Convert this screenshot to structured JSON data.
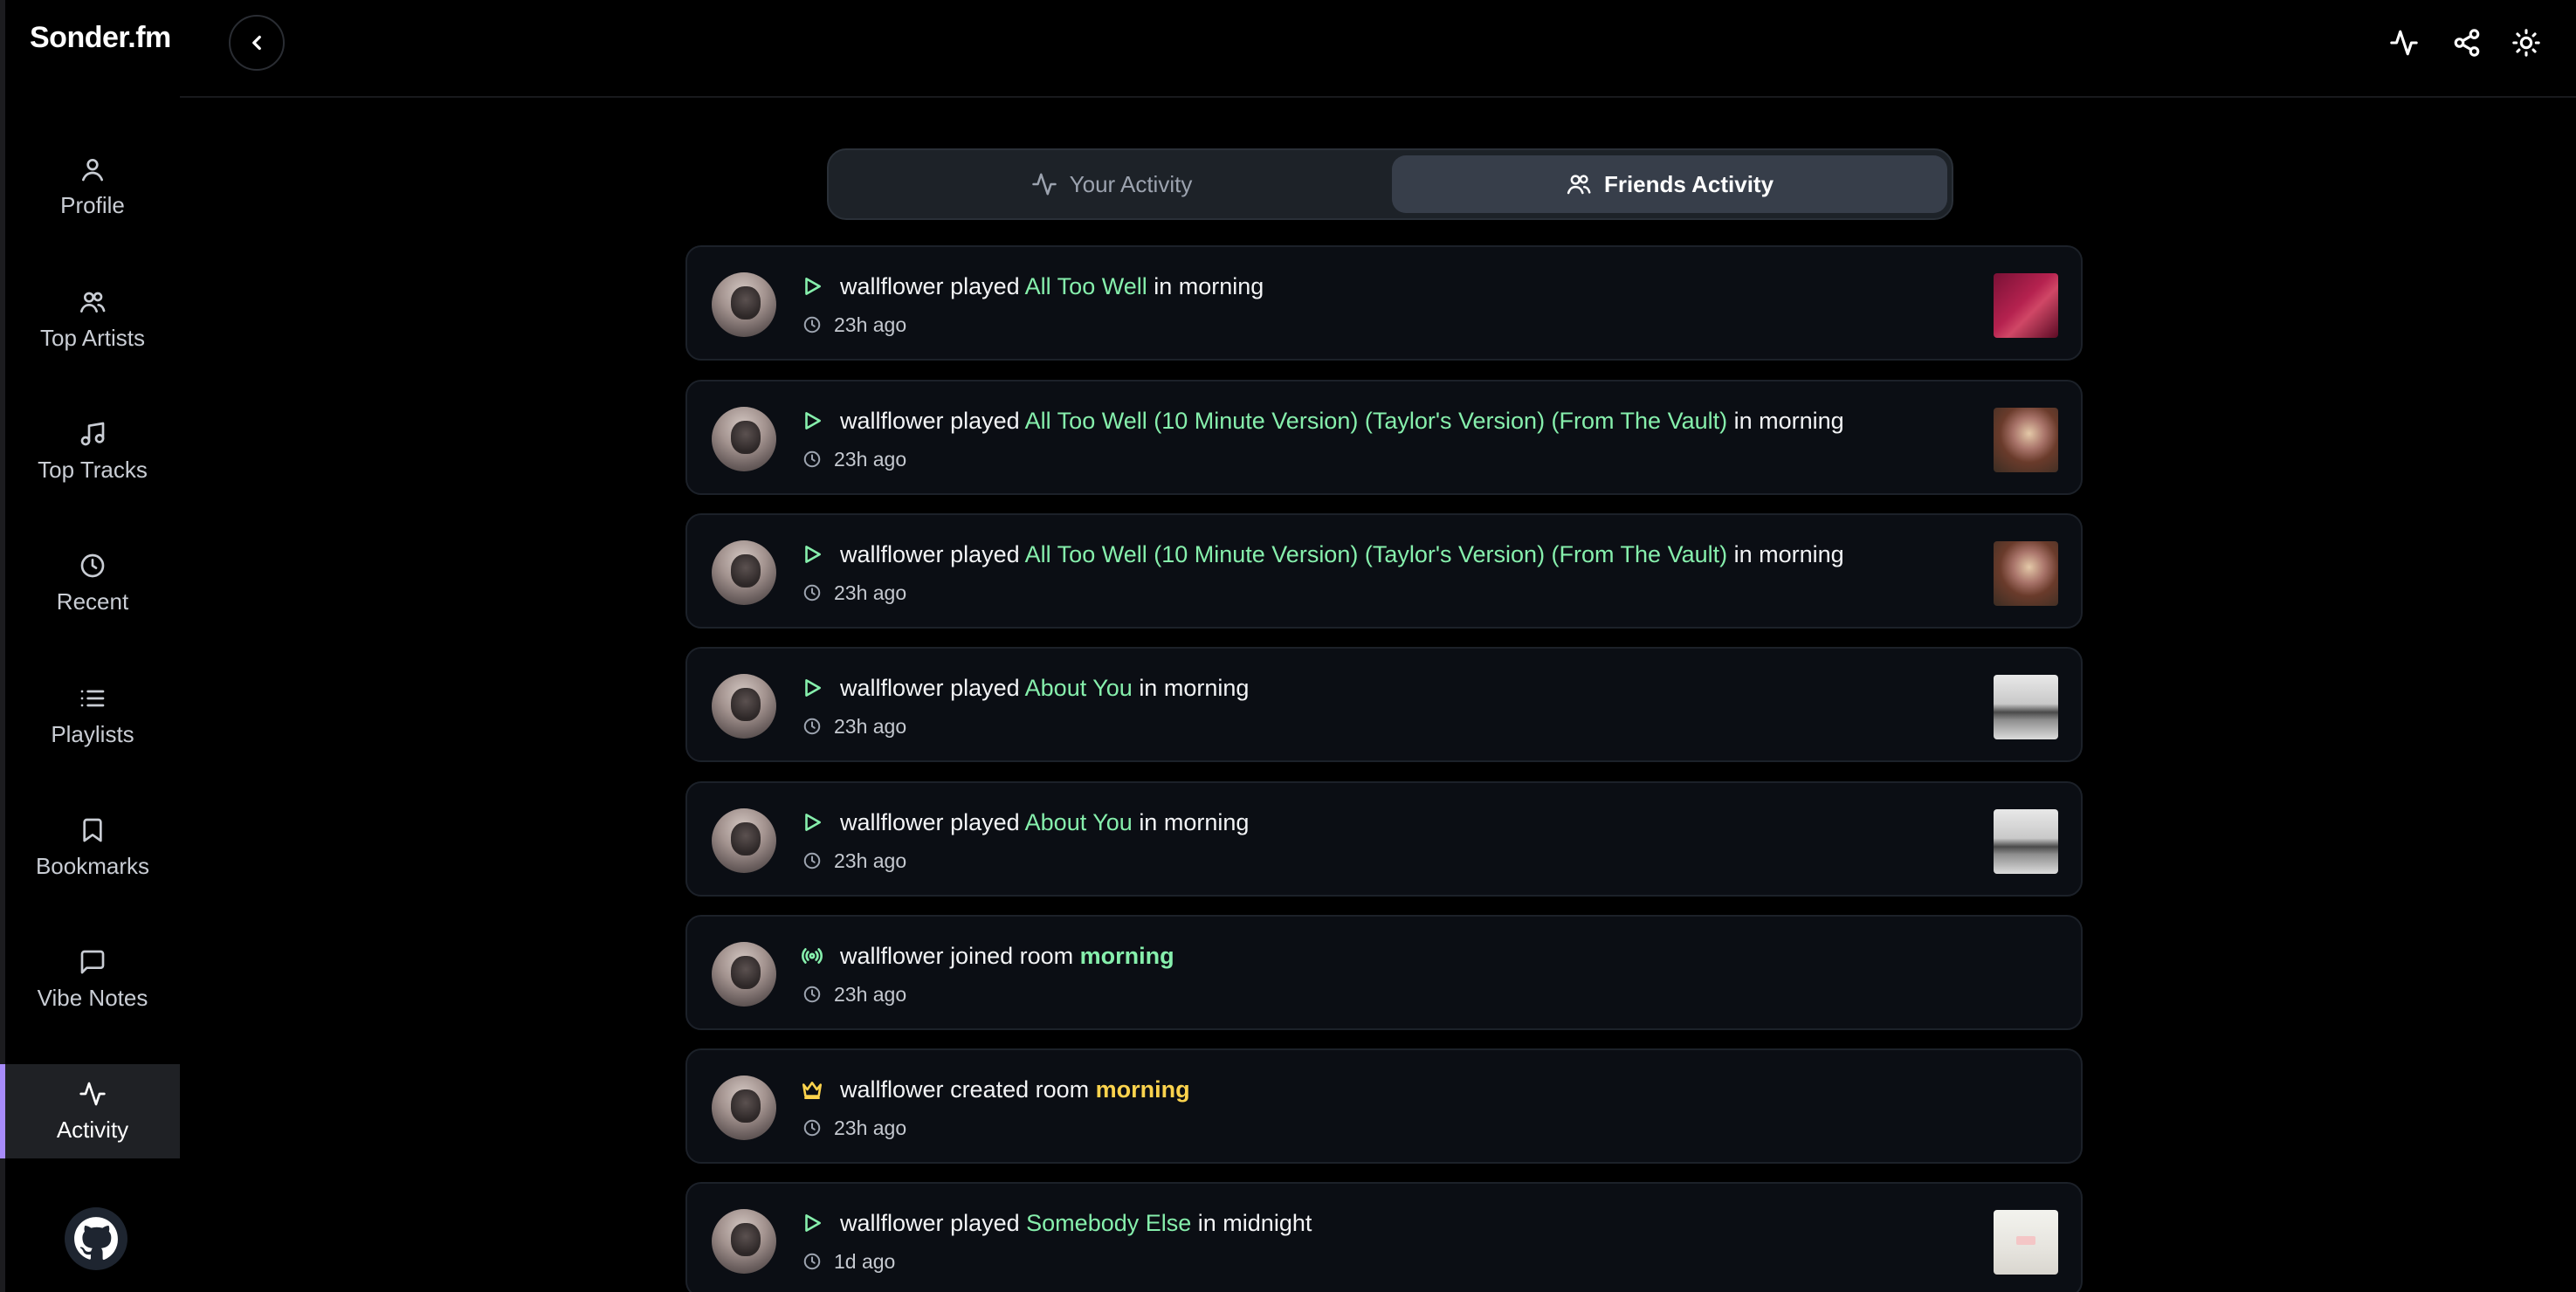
{
  "app": {
    "logo": "Sonder.fm"
  },
  "sidebar": {
    "items": [
      {
        "label": "Profile",
        "icon": "user-icon"
      },
      {
        "label": "Top Artists",
        "icon": "users-icon"
      },
      {
        "label": "Top Tracks",
        "icon": "music-note-icon"
      },
      {
        "label": "Recent",
        "icon": "clock-icon"
      },
      {
        "label": "Playlists",
        "icon": "list-icon"
      },
      {
        "label": "Bookmarks",
        "icon": "bookmark-icon"
      },
      {
        "label": "Vibe Notes",
        "icon": "message-square-icon"
      },
      {
        "label": "Activity",
        "icon": "activity-icon",
        "active": true
      }
    ],
    "github_icon": "github-icon"
  },
  "header": {
    "back_icon": "chevron-left-icon",
    "actions": [
      "activity-icon",
      "share-icon",
      "sun-icon"
    ]
  },
  "tabs": {
    "your_activity": "Your Activity",
    "friends_activity": "Friends Activity",
    "selected": "Friends Activity"
  },
  "feed": [
    {
      "user": "wallflower",
      "verb": "played",
      "track": "All Too Well",
      "suffix": "in morning",
      "time": "23h ago",
      "type": "play"
    },
    {
      "user": "wallflower",
      "verb": "played",
      "track": "All Too Well (10 Minute Version) (Taylor's Version) (From The Vault)",
      "suffix": "in morning",
      "time": "23h ago",
      "type": "play"
    },
    {
      "user": "wallflower",
      "verb": "played",
      "track": "All Too Well (10 Minute Version) (Taylor's Version) (From The Vault)",
      "suffix": "in morning",
      "time": "23h ago",
      "type": "play"
    },
    {
      "user": "wallflower",
      "verb": "played",
      "track": "About You",
      "suffix": "in morning",
      "time": "23h ago",
      "type": "play"
    },
    {
      "user": "wallflower",
      "verb": "played",
      "track": "About You",
      "suffix": "in morning",
      "time": "23h ago",
      "type": "play"
    },
    {
      "user": "wallflower",
      "verb": "joined room",
      "track": "morning",
      "suffix": "",
      "time": "23h ago",
      "type": "join"
    },
    {
      "user": "wallflower",
      "verb": "created room",
      "track": "morning",
      "suffix": "",
      "time": "23h ago",
      "type": "create"
    },
    {
      "user": "wallflower",
      "verb": "played",
      "track": "Somebody Else",
      "suffix": "in midnight",
      "time": "1d ago",
      "type": "play"
    }
  ],
  "colors": {
    "accent_green": "#86efac",
    "accent_gold": "#fcd34d",
    "active_bar": "#a78bfa"
  }
}
